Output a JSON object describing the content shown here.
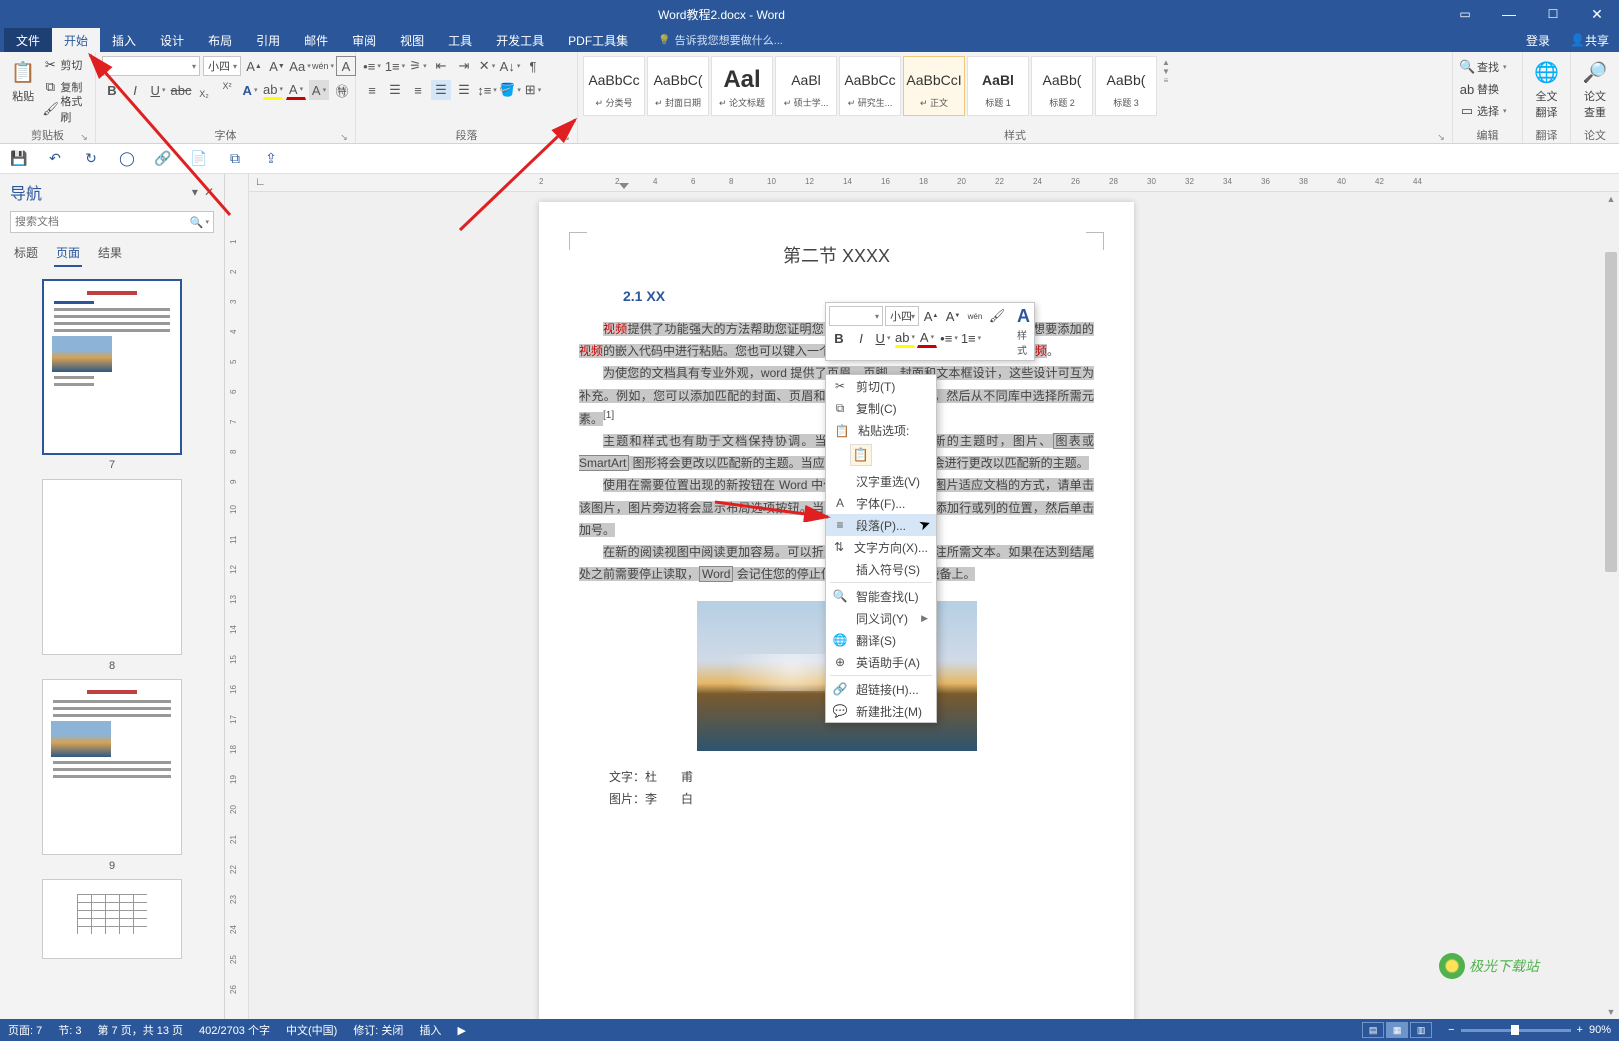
{
  "titlebar": {
    "title": "Word教程2.docx - Word"
  },
  "account": {
    "login": "登录",
    "share": "共享"
  },
  "tabs": {
    "file": "文件",
    "home": "开始",
    "insert": "插入",
    "design": "设计",
    "layout": "布局",
    "references": "引用",
    "mailings": "邮件",
    "review": "审阅",
    "view": "视图",
    "tools": "工具",
    "devtools": "开发工具",
    "pdf": "PDF工具集",
    "tell": "告诉我您想要做什么..."
  },
  "groups": {
    "clipboard": {
      "name": "剪贴板",
      "paste": "粘贴",
      "cut": "剪切",
      "copy": "复制",
      "format_painter": "格式刷"
    },
    "font": {
      "name": "字体",
      "font_name": "",
      "font_size": "小四"
    },
    "paragraph": {
      "name": "段落"
    },
    "styles": {
      "name": "样式",
      "items": [
        {
          "preview": "AaBbCc",
          "label": "↵ 分类号"
        },
        {
          "preview": "AaBbC(",
          "label": "↵ 封面日期"
        },
        {
          "preview": "Aal",
          "label": "↵ 论文标题",
          "big": true
        },
        {
          "preview": "AaBl",
          "label": "↵ 硕士学..."
        },
        {
          "preview": "AaBbCc",
          "label": "↵ 研究生..."
        },
        {
          "preview": "AaBbCcI",
          "label": "↵ 正文",
          "selected": true
        },
        {
          "preview": "AaBl",
          "label": "标题 1",
          "bold": true
        },
        {
          "preview": "AaBb(",
          "label": "标题 2"
        },
        {
          "preview": "AaBb(",
          "label": "标题 3"
        }
      ]
    },
    "editing": {
      "name": "编辑",
      "find": "查找",
      "replace": "替换",
      "select": "选择"
    },
    "translate": {
      "name": "翻译",
      "full": "全文",
      "full2": "翻译"
    },
    "thesis": {
      "name": "论文",
      "check": "论文",
      "check2": "查重"
    }
  },
  "nav": {
    "title": "导航",
    "search_placeholder": "搜索文档",
    "tabs": {
      "headings": "标题",
      "pages": "页面",
      "results": "结果"
    },
    "pages": [
      "7",
      "8",
      "9"
    ]
  },
  "doc": {
    "section_title": "第二节  XXXX",
    "subhead": "2.1 XX",
    "kw": "视频",
    "p1a": "提供了功能强大的方法帮助您证明您的观点。当您单击联机",
    "p1b": "时，可以在想要添加的",
    "p1c": "的嵌入代码中进行粘贴。您也可以键入一个关键字以联机搜索最适合您的文档的",
    "p1d": "。",
    "p2": "为使您的文档具有专业外观，word 提供了页眉、页脚、封面和文本框设计，这些设计可互为补充。例如，您可以添加匹配的封面、页眉和提要栏。单击\"插入\"，然后从不同库中选择所需元素。",
    "ref1": "[1]",
    "p3a": "主题和样式也有助于文档保持协调。当您单击设计并选择新的主题时，图片、",
    "p3b": "图表或 SmartArt",
    "p3c": " 图形将会更改以匹配新的主题。当应用样式时，您的标题会进行更改以匹配新的主题。",
    "p4a": "使用在需要位置出现的新按钮在 Word 中保存时间。若要更改图片适应文档的方式，请单击该图片，图片旁边将会显示布局选项按钮。当处理表格时，单击要添加行或列的位置，然后单击加号。",
    "p5a": "在新的阅读视图中阅读更加容易。可以折叠文档某些部分并关注所需文本。如果在达到结尾处之前需要停止读取，",
    "p5b": "Word",
    "p5c": " 会记住您的停止位置 - 即使在另一个设备上。",
    "credit1_label": "文字：",
    "credit1_value": "杜　　甫",
    "credit2_label": "图片：",
    "credit2_value": "李　　白"
  },
  "minitoolbar": {
    "size": "小四",
    "styles_label": "样式"
  },
  "context_menu": {
    "cut": "剪切(T)",
    "copy": "复制(C)",
    "paste_header": "粘贴选项:",
    "hanzi": "汉字重选(V)",
    "font": "字体(F)...",
    "paragraph": "段落(P)...",
    "direction": "文字方向(X)...",
    "symbol": "插入符号(S)",
    "smart": "智能查找(L)",
    "synonym": "同义词(Y)",
    "translate": "翻译(S)",
    "eng": "英语助手(A)",
    "hyperlink": "超链接(H)...",
    "comment": "新建批注(M)"
  },
  "status": {
    "page": "页面: 7",
    "section": "节: 3",
    "page_of": "第 7 页，共 13 页",
    "pos": "402/2703 个字",
    "lang": "中文(中国)",
    "track": "修订: 关闭",
    "insert": "插入",
    "zoom": "90%"
  },
  "watermark": "极光下载站"
}
